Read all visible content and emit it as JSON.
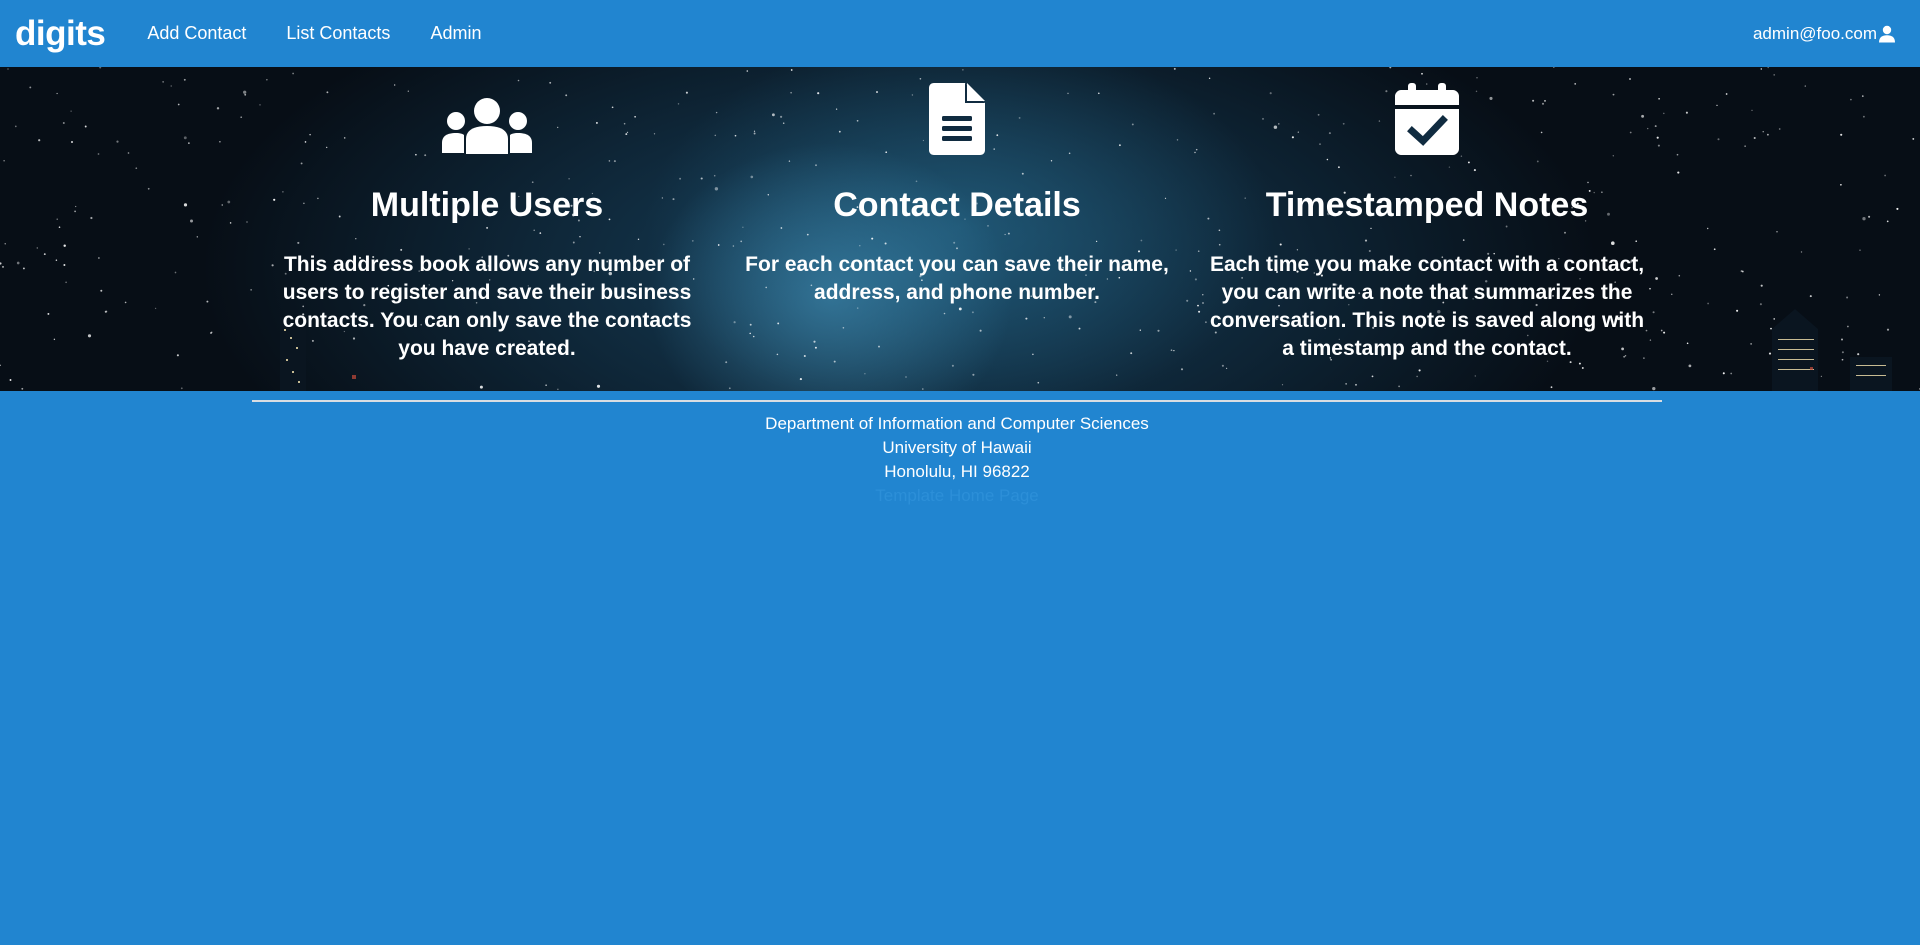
{
  "navbar": {
    "brand": "digits",
    "items": [
      {
        "label": "Add Contact"
      },
      {
        "label": "List Contacts"
      },
      {
        "label": "Admin"
      }
    ],
    "user": {
      "email": "admin@foo.com",
      "icon": "user-icon"
    }
  },
  "landing": {
    "columns": [
      {
        "icon": "users-icon",
        "heading": "Multiple Users",
        "text": "This address book allows any number of users to register and save their business contacts. You can only save the contacts you have created."
      },
      {
        "icon": "file-text-icon",
        "heading": "Contact Details",
        "text": "For each contact you can save their name, address, and phone number."
      },
      {
        "icon": "calendar-check-icon",
        "heading": "Timestamped Notes",
        "text": "Each time you make contact with a contact, you can write a note that summarizes the conversation. This note is saved along with a timestamp and the contact."
      }
    ]
  },
  "footer": {
    "line1": "Department of Information and Computer Sciences",
    "line2": "University of Hawaii",
    "line3": "Honolulu, HI 96822",
    "link": "Template Home Page"
  },
  "colors": {
    "primary": "#2185d0",
    "text": "#ffffff"
  }
}
